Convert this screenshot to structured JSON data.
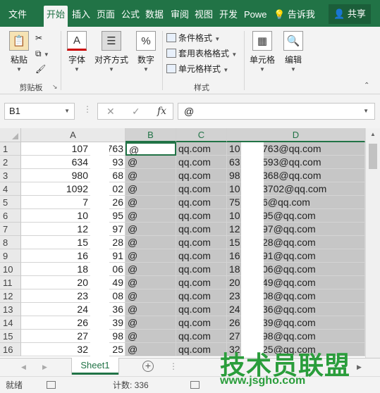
{
  "tabs": [
    {
      "label": "文件"
    },
    {
      "label": "开始"
    },
    {
      "label": "插入"
    },
    {
      "label": "页面"
    },
    {
      "label": "公式"
    },
    {
      "label": "数据"
    },
    {
      "label": "审阅"
    },
    {
      "label": "视图"
    },
    {
      "label": "开发"
    },
    {
      "label": "Powe"
    }
  ],
  "tell_me": "告诉我",
  "share": "共享",
  "ribbon": {
    "paste": "粘贴",
    "clipboard_group": "剪贴板",
    "font": "字体",
    "align": "对齐方式",
    "number": "数字",
    "conditional": "条件格式",
    "table_format": "套用表格格式",
    "cell_style": "单元格样式",
    "styles_group": "样式",
    "cells": "单元格",
    "edit": "编辑"
  },
  "formula_bar": {
    "name_box": "B1",
    "formula": "@"
  },
  "columns": [
    "A",
    "B",
    "C",
    "D"
  ],
  "rows": [
    {
      "n": "1",
      "a": "107",
      "a2": "763",
      "b": "@",
      "c": "qq.com",
      "d1": "10",
      "d2": "763@qq.com"
    },
    {
      "n": "2",
      "a": "634",
      "a2": "93",
      "b": "@",
      "c": "qq.com",
      "d1": "63",
      "d2": "593@qq.com"
    },
    {
      "n": "3",
      "a": "980",
      "a2": "68",
      "b": "@",
      "c": "qq.com",
      "d1": "98",
      "d2": "368@qq.com"
    },
    {
      "n": "4",
      "a": "1092",
      "a2": "02",
      "b": "@",
      "c": "qq.com",
      "d1": "10",
      "d2": "3702@qq.com"
    },
    {
      "n": "5",
      "a": "7",
      "a2": "26",
      "b": "@",
      "c": "qq.com",
      "d1": "75",
      "d2": "6@qq.com"
    },
    {
      "n": "6",
      "a": "10",
      "a2": "95",
      "b": "@",
      "c": "qq.com",
      "d1": "10",
      "d2": "95@qq.com"
    },
    {
      "n": "7",
      "a": "12",
      "a2": "97",
      "b": "@",
      "c": "qq.com",
      "d1": "12",
      "d2": "97@qq.com"
    },
    {
      "n": "8",
      "a": "15",
      "a2": "28",
      "b": "@",
      "c": "qq.com",
      "d1": "15",
      "d2": "28@qq.com"
    },
    {
      "n": "9",
      "a": "16",
      "a2": "91",
      "b": "@",
      "c": "qq.com",
      "d1": "16",
      "d2": "91@qq.com"
    },
    {
      "n": "10",
      "a": "18",
      "a2": "06",
      "b": "@",
      "c": "qq.com",
      "d1": "18",
      "d2": "06@qq.com"
    },
    {
      "n": "11",
      "a": "20",
      "a2": "49",
      "b": "@",
      "c": "qq.com",
      "d1": "20",
      "d2": "49@qq.com"
    },
    {
      "n": "12",
      "a": "23",
      "a2": "08",
      "b": "@",
      "c": "qq.com",
      "d1": "23",
      "d2": "08@qq.com"
    },
    {
      "n": "13",
      "a": "24",
      "a2": "36",
      "b": "@",
      "c": "qq.com",
      "d1": "24",
      "d2": "36@qq.com"
    },
    {
      "n": "14",
      "a": "26",
      "a2": "39",
      "b": "@",
      "c": "qq.com",
      "d1": "26",
      "d2": "39@qq.com"
    },
    {
      "n": "15",
      "a": "27",
      "a2": "98",
      "b": "@",
      "c": "qq.com",
      "d1": "27",
      "d2": "98@qq.com"
    },
    {
      "n": "16",
      "a": "32",
      "a2": "25",
      "b": "@",
      "c": "qq.com",
      "d1": "32",
      "d2": "25@qq.com"
    }
  ],
  "sheet_tab": "Sheet1",
  "status": {
    "ready": "就绪",
    "count": "计数: 336"
  },
  "watermark": {
    "title": "技术员联盟",
    "url": "www.jsgho.com"
  },
  "colors": {
    "brand": "#217346",
    "selection": "#c6c6c6",
    "watermark": "#2a9d3b"
  }
}
